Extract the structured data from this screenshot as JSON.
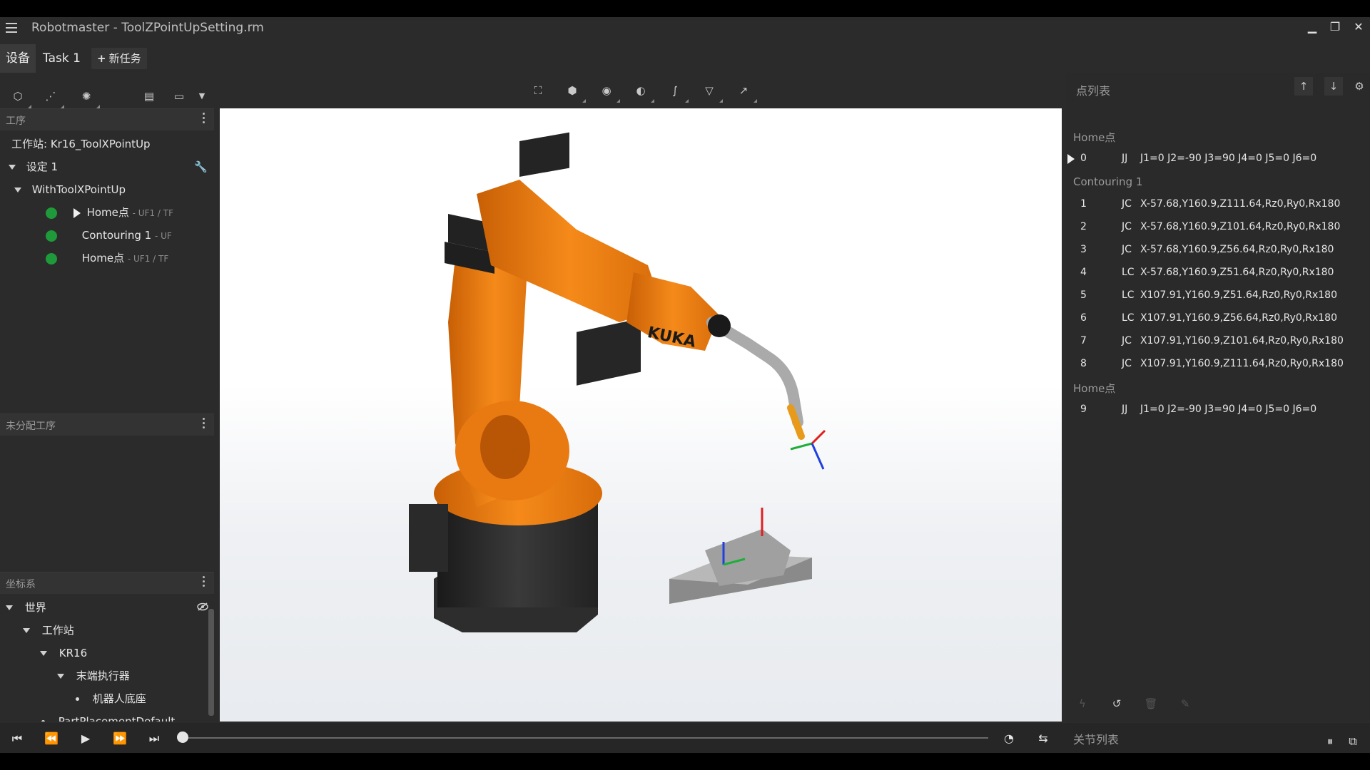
{
  "window": {
    "title": "Robotmaster - ToolZPointUpSetting.rm",
    "min_icon": "minimize-icon",
    "restore_icon": "restore-icon",
    "close_icon": "close-icon"
  },
  "tabs": {
    "device": "设备",
    "task1": "Task 1",
    "new_task": "新任务"
  },
  "left": {
    "operations_header": "工序",
    "workstation_label": "工作站: Kr16_ToolXPointUp",
    "setup_label": "设定 1",
    "program_label": "WithToolXPointUp",
    "ops": [
      {
        "name": "Home点",
        "meta": "- UF1 / TF"
      },
      {
        "name": "Contouring 1",
        "meta": "- UF"
      },
      {
        "name": "Home点",
        "meta": "- UF1 / TF"
      }
    ],
    "unassigned_header": "未分配工序",
    "frames_header": "坐标系",
    "frames": {
      "world": "世界",
      "workstation": "工作站",
      "kr16": "KR16",
      "end_effector": "末端执行器",
      "robot_base": "机器人底座",
      "part_placement": "PartPlacementDefault"
    }
  },
  "right": {
    "header": "点列表",
    "groups": {
      "home1": "Home点",
      "contouring": "Contouring 1",
      "home2": "Home点"
    },
    "points": [
      {
        "idx": "0",
        "mt": "JJ",
        "val": "J1=0 J2=-90 J3=90 J4=0 J5=0 J6=0"
      },
      {
        "idx": "1",
        "mt": "JC",
        "val": "X-57.68,Y160.9,Z111.64,Rz0,Ry0,Rx180"
      },
      {
        "idx": "2",
        "mt": "JC",
        "val": "X-57.68,Y160.9,Z101.64,Rz0,Ry0,Rx180"
      },
      {
        "idx": "3",
        "mt": "JC",
        "val": "X-57.68,Y160.9,Z56.64,Rz0,Ry0,Rx180"
      },
      {
        "idx": "4",
        "mt": "LC",
        "val": "X-57.68,Y160.9,Z51.64,Rz0,Ry0,Rx180"
      },
      {
        "idx": "5",
        "mt": "LC",
        "val": "X107.91,Y160.9,Z51.64,Rz0,Ry0,Rx180"
      },
      {
        "idx": "6",
        "mt": "LC",
        "val": "X107.91,Y160.9,Z56.64,Rz0,Ry0,Rx180"
      },
      {
        "idx": "7",
        "mt": "JC",
        "val": "X107.91,Y160.9,Z101.64,Rz0,Ry0,Rx180"
      },
      {
        "idx": "8",
        "mt": "JC",
        "val": "X107.91,Y160.9,Z111.64,Rz0,Ry0,Rx180"
      },
      {
        "idx": "9",
        "mt": "JJ",
        "val": "J1=0 J2=-90 J3=90 J4=0 J5=0 J6=0"
      }
    ],
    "joint_list": "关节列表"
  },
  "colors": {
    "robot_orange": "#f07f12",
    "robot_black": "#2a2a2a",
    "status_green": "#1f9a3a",
    "axis_red": "#e02020",
    "axis_green": "#1fae3a",
    "axis_blue": "#2040e0"
  }
}
